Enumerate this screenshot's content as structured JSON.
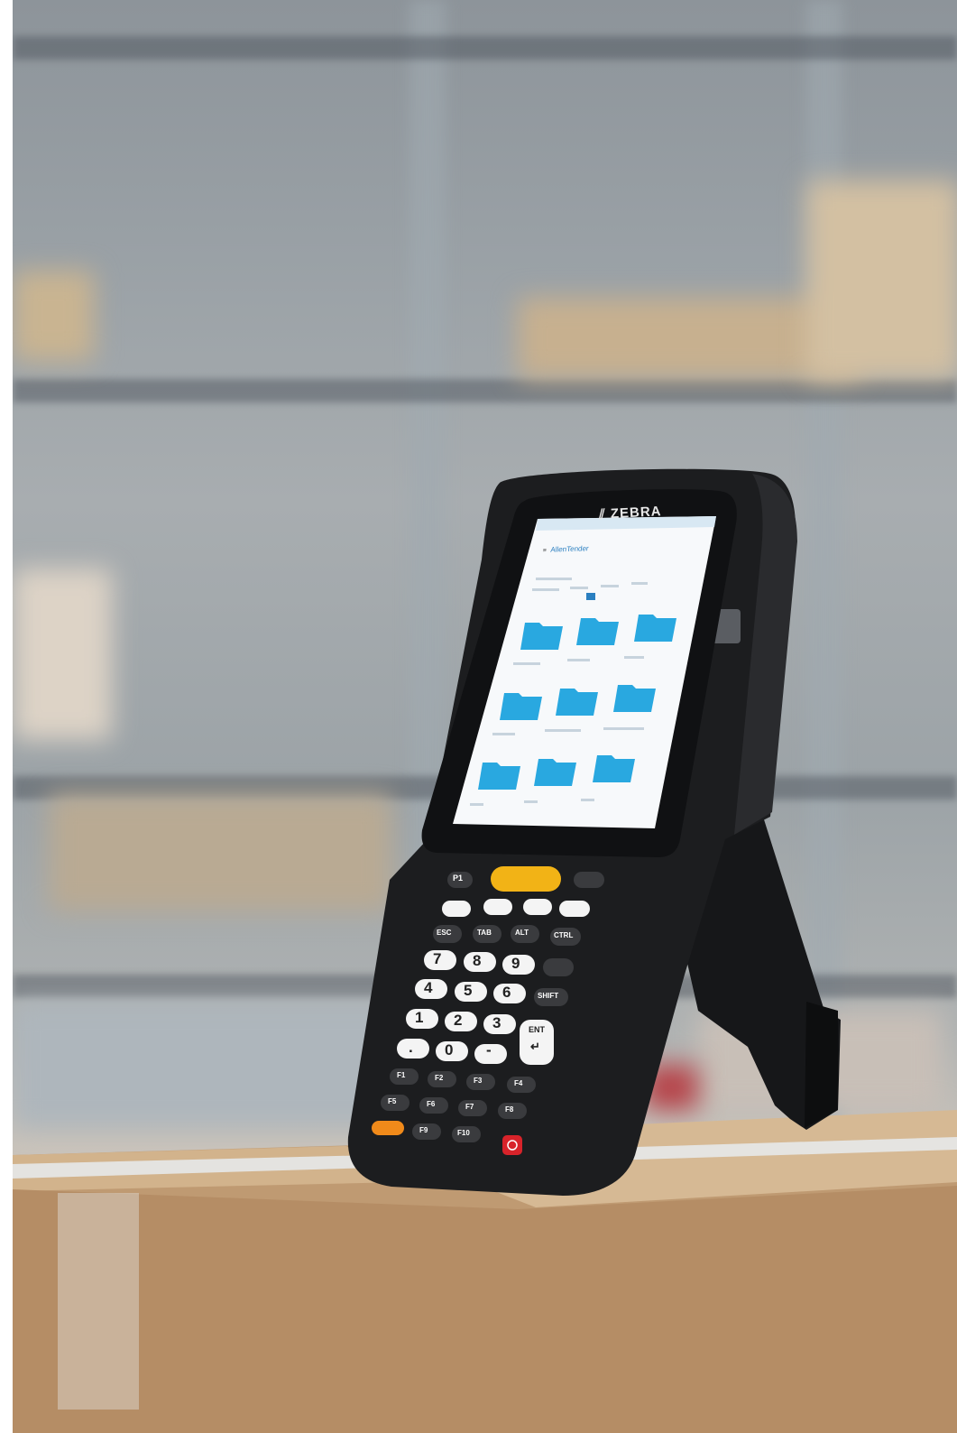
{
  "brand": {
    "logo_text": "ZEBRA"
  },
  "screen": {
    "app_title": "AllenTender"
  },
  "keypad": {
    "top_left_key": "P1",
    "row_nav_esc": "ESC",
    "row_nav_tab": "TAB",
    "row_nav_alt": "ALT",
    "row_nav_ctrl": "CTRL",
    "shift": "SHIFT",
    "enter_top": "ENT",
    "enter_bottom": "↵",
    "digits": [
      "7",
      "8",
      "9",
      "4",
      "5",
      "6",
      "1",
      "2",
      "3",
      ".",
      "0",
      "-"
    ],
    "fkeys": [
      "F1",
      "F2",
      "F3",
      "F4",
      "F5",
      "F6",
      "F7",
      "F8",
      "F9",
      "F10"
    ]
  },
  "colors": {
    "device_body": "#1c1d1f",
    "screen_bg": "#f7f9fb",
    "folder": "#29a8e0",
    "accent_yellow": "#f2b316",
    "accent_orange": "#f08a1a",
    "power_red": "#d8232a",
    "white_keys": "#f4f4f4"
  }
}
